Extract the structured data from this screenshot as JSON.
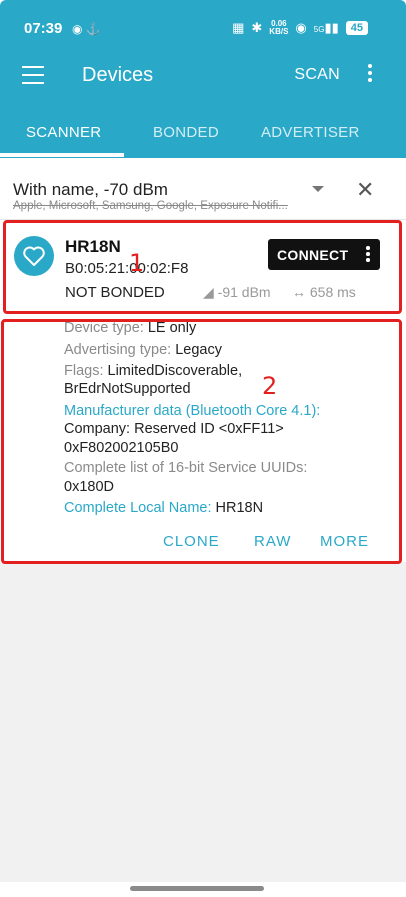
{
  "status_bar": {
    "time": "07:39",
    "left_icons": "◉ ⚓",
    "speed_value": "0.06",
    "speed_unit": "KB/S",
    "network": "5G",
    "battery": "45"
  },
  "app_bar": {
    "title": "Devices",
    "scan_label": "SCAN"
  },
  "tabs": [
    {
      "label": "SCANNER",
      "active": true
    },
    {
      "label": "BONDED",
      "active": false
    },
    {
      "label": "ADVERTISER",
      "active": false
    }
  ],
  "filter": {
    "title": "With name, -70 dBm",
    "excluded": "Apple, Microsoft, Samsung, Google, Exposure Notifi..."
  },
  "device": {
    "name": "HR18N",
    "address": "B0:05:21:00:02:F8",
    "bond_state": "NOT BONDED",
    "rssi": "-91 dBm",
    "interval": "658 ms",
    "connect_label": "CONNECT"
  },
  "details": {
    "device_type_key": "Device type: ",
    "device_type_val": "LE only",
    "adv_type_key": "Advertising type: ",
    "adv_type_val": "Legacy",
    "flags_key": "Flags: ",
    "flags_val_1": "LimitedDiscoverable,",
    "flags_val_2": "BrEdrNotSupported",
    "manufacturer_key": "Manufacturer data (Bluetooth Core 4.1):",
    "company": "Company: Reserved ID <0xFF11>",
    "manufacturer_data": "0xF802002105B0",
    "uuids_key": "Complete list of 16-bit Service UUIDs:",
    "uuids_val": "0x180D",
    "local_name_key": "Complete Local Name: ",
    "local_name_val": "HR18N",
    "actions": [
      "CLONE",
      "RAW",
      "MORE"
    ]
  },
  "annotations": [
    "1",
    "2"
  ],
  "colors": {
    "accent": "#2aa8c8",
    "highlight": "#e32020"
  }
}
